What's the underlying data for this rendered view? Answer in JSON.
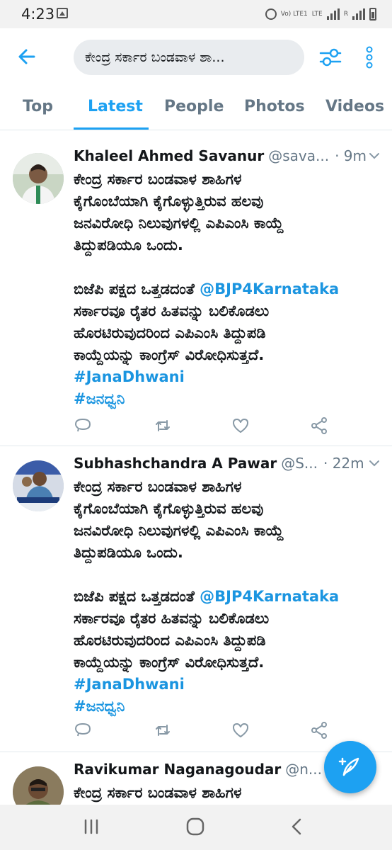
{
  "status_bar": {
    "time": "4:23",
    "network": "LTE",
    "network_sub": "Vo) LTE1",
    "sim_label": "R"
  },
  "header": {
    "search_query": "ಕೇಂದ್ರ ಸರ್ಕಾರ ಬಂಡವಾಳ ಶಾ...",
    "back_icon": "arrow-left-icon",
    "filter_icon": "sliders-icon",
    "more_icon": "more-vertical-icon"
  },
  "tabs": [
    {
      "label": "Top",
      "active": false
    },
    {
      "label": "Latest",
      "active": true
    },
    {
      "label": "People",
      "active": false
    },
    {
      "label": "Photos",
      "active": false
    },
    {
      "label": "Videos",
      "active": false
    }
  ],
  "tweets": [
    {
      "name": "Khaleel Ahmed Savanur",
      "handle": "@sava...",
      "time": "· 9m",
      "line1": "ಕೇಂದ್ರ ಸರ್ಕಾರ ಬಂಡವಾಳ ಶಾಹಿಗಳ",
      "line2": "ಕೈಗೊಂಬೆಯಾಗಿ ಕೈಗೊಳ್ಳುತ್ತಿರುವ ಹಲವು",
      "line3": "ಜನವಿರೋಧಿ ನಿಲುವುಗಳಲ್ಲಿ ಎಪಿಎಂಸಿ ಕಾಯ್ದೆ",
      "line4": "ತಿದ್ದುಪಡಿಯೂ ಒಂದು.",
      "line5_pre": "ಬಿಜೆಪಿ ಪಕ್ಷದ ಒತ್ತಡದಂತೆ ",
      "mention": "@BJP4Karnataka",
      "line6": "ಸರ್ಕಾರವೂ ರೈತರ ಹಿತವನ್ನು ಬಲಿಕೊಡಲು",
      "line7": "ಹೊರಟಿರುವುದರಿಂದ ಎಪಿಎಂಸಿ ತಿದ್ದುಪಡಿ",
      "line8": "ಕಾಯ್ದೆಯನ್ನು ಕಾಂಗ್ರೆಸ್ ವಿರೋಧಿಸುತ್ತದೆ.",
      "hashtag1": "#JanaDhwani",
      "hashtag2": "#ಜನಧ್ವನಿ"
    },
    {
      "name": "Subhashchandra A Pawar",
      "handle": "@S...",
      "time": "· 22m",
      "line1": "ಕೇಂದ್ರ ಸರ್ಕಾರ ಬಂಡವಾಳ ಶಾಹಿಗಳ",
      "line2": "ಕೈಗೊಂಬೆಯಾಗಿ ಕೈಗೊಳ್ಳುತ್ತಿರುವ ಹಲವು",
      "line3": "ಜನವಿರೋಧಿ ನಿಲುವುಗಳಲ್ಲಿ ಎಪಿಎಂಸಿ ಕಾಯ್ದೆ",
      "line4": "ತಿದ್ದುಪಡಿಯೂ ಒಂದು.",
      "line5_pre": "ಬಿಜೆಪಿ ಪಕ್ಷದ ಒತ್ತಡದಂತೆ ",
      "mention": "@BJP4Karnataka",
      "line6": "ಸರ್ಕಾರವೂ ರೈತರ ಹಿತವನ್ನು ಬಲಿಕೊಡಲು",
      "line7": "ಹೊರಟಿರುವುದರಿಂದ ಎಪಿಎಂಸಿ ತಿದ್ದುಪಡಿ",
      "line8": "ಕಾಯ್ದೆಯನ್ನು ಕಾಂಗ್ರೆಸ್ ವಿರೋಧಿಸುತ್ತದೆ.",
      "hashtag1": "#JanaDhwani",
      "hashtag2": "#ಜನಧ್ವನಿ"
    },
    {
      "name": "Ravikumar Naganagoudar",
      "handle": "@n...",
      "line1": "ಕೇಂದ್ರ ಸರ್ಕಾರ ಬಂಡವಾಳ ಶಾಹಿಗಳ"
    }
  ],
  "colors": {
    "accent": "#1da1f2",
    "link": "#1b95e0",
    "secondary_text": "#657786"
  }
}
